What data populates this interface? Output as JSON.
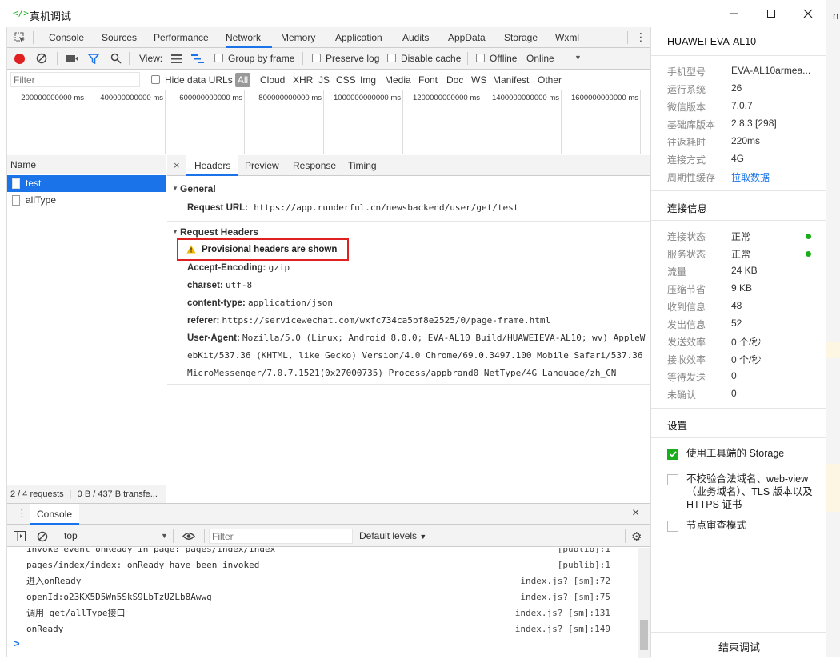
{
  "window": {
    "title": "真机调试",
    "logo": "</>",
    "icons": [
      "minimize-icon",
      "maximize-icon",
      "close-icon"
    ]
  },
  "outside": {
    "letter": "n"
  },
  "devtools": {
    "tabs": [
      "Console",
      "Sources",
      "Performance",
      "Network",
      "Memory",
      "Application",
      "Audits",
      "AppData",
      "Storage",
      "Wxml"
    ],
    "active_tab": "Network",
    "toolbar": {
      "view_label": "View:",
      "group_by_frame": "Group by frame",
      "preserve_log": "Preserve log",
      "disable_cache": "Disable cache",
      "offline": "Offline",
      "throttle": "Online"
    },
    "filter": {
      "placeholder": "Filter",
      "hide_data_urls": "Hide data URLs",
      "types": [
        "All",
        "Cloud",
        "XHR",
        "JS",
        "CSS",
        "Img",
        "Media",
        "Font",
        "Doc",
        "WS",
        "Manifest",
        "Other"
      ]
    },
    "timeline": [
      "200000000000 ms",
      "400000000000 ms",
      "600000000000 ms",
      "800000000000 ms",
      "1000000000000 ms",
      "1200000000000 ms",
      "1400000000000 ms",
      "1600000000000 ms"
    ],
    "requests": {
      "header": "Name",
      "items": [
        "test",
        "allType"
      ],
      "selected": "test",
      "status": "2 / 4 requests",
      "transfer": "0 B / 437 B transfe..."
    },
    "detail": {
      "tabs": [
        "Headers",
        "Preview",
        "Response",
        "Timing"
      ],
      "active": "Headers",
      "general_title": "General",
      "request_url_label": "Request URL:",
      "request_url": "https://app.runderful.cn/newsbackend/user/get/test",
      "request_headers_title": "Request Headers",
      "provisional": "Provisional headers are shown",
      "headers": [
        {
          "k": "Accept-Encoding:",
          "v": "gzip"
        },
        {
          "k": "charset:",
          "v": "utf-8"
        },
        {
          "k": "content-type:",
          "v": "application/json"
        },
        {
          "k": "referer:",
          "v": "https://servicewechat.com/wxfc734ca5bf8e2525/0/page-frame.html"
        },
        {
          "k": "User-Agent:",
          "v": "Mozilla/5.0 (Linux; Android 8.0.0; EVA-AL10 Build/HUAWEIEVA-AL10; wv) AppleW"
        }
      ],
      "ua_cont": [
        "ebKit/537.36 (KHTML, like Gecko) Version/4.0 Chrome/69.0.3497.100 Mobile Safari/537.36",
        "MicroMessenger/7.0.7.1521(0x27000735) Process/appbrand0 NetType/4G Language/zh_CN"
      ]
    },
    "console": {
      "title": "Console",
      "context": "top",
      "filter_placeholder": "Filter",
      "levels": "Default levels",
      "lines": [
        {
          "msg": "invoke event onReady in page: pages/index/index",
          "src": "[publib]:1"
        },
        {
          "msg": "pages/index/index: onReady have been invoked",
          "src": "[publib]:1"
        },
        {
          "msg": "进入onReady",
          "src": "index.js? [sm]:72"
        },
        {
          "msg": "openId:o23KX5D5Wn5SkS9LbTzUZLb8Awwg",
          "src": "index.js? [sm]:75"
        },
        {
          "msg": "调用 get/allType接口",
          "src": "index.js? [sm]:131"
        },
        {
          "msg": "onReady",
          "src": "index.js? [sm]:149"
        }
      ],
      "prompt": ">"
    }
  },
  "panel": {
    "device": "HUAWEI-EVA-AL10",
    "info": [
      {
        "k": "手机型号",
        "v": "EVA-AL10armea..."
      },
      {
        "k": "运行系统",
        "v": "26"
      },
      {
        "k": "微信版本",
        "v": "7.0.7"
      },
      {
        "k": "基础库版本",
        "v": "2.8.3 [298]"
      },
      {
        "k": "往返耗时",
        "v": "220ms"
      },
      {
        "k": "连接方式",
        "v": "4G"
      },
      {
        "k": "周期性缓存",
        "v": "拉取数据"
      }
    ],
    "conn_title": "连接信息",
    "conn": [
      {
        "k": "连接状态",
        "v": "正常"
      },
      {
        "k": "服务状态",
        "v": "正常"
      },
      {
        "k": "流量",
        "v": "24 KB"
      },
      {
        "k": "压缩节省",
        "v": "9 KB"
      },
      {
        "k": "收到信息",
        "v": "48"
      },
      {
        "k": "发出信息",
        "v": "52"
      },
      {
        "k": "发送效率",
        "v": "0 个/秒"
      },
      {
        "k": "接收效率",
        "v": "0 个/秒"
      },
      {
        "k": "等待发送",
        "v": "0"
      },
      {
        "k": "未确认",
        "v": "0"
      }
    ],
    "settings_title": "设置",
    "settings": [
      {
        "label": "使用工具端的 Storage",
        "checked": true
      },
      {
        "label": "不校验合法域名、web-view（业务域名）、TLS 版本以及 HTTPS 证书",
        "checked": false
      },
      {
        "label": "节点审查模式",
        "checked": false
      }
    ],
    "end_button": "结束调试",
    "colors": {
      "accent": "#1aad19",
      "link": "#1a73e8",
      "highlight": "#e02020"
    }
  }
}
